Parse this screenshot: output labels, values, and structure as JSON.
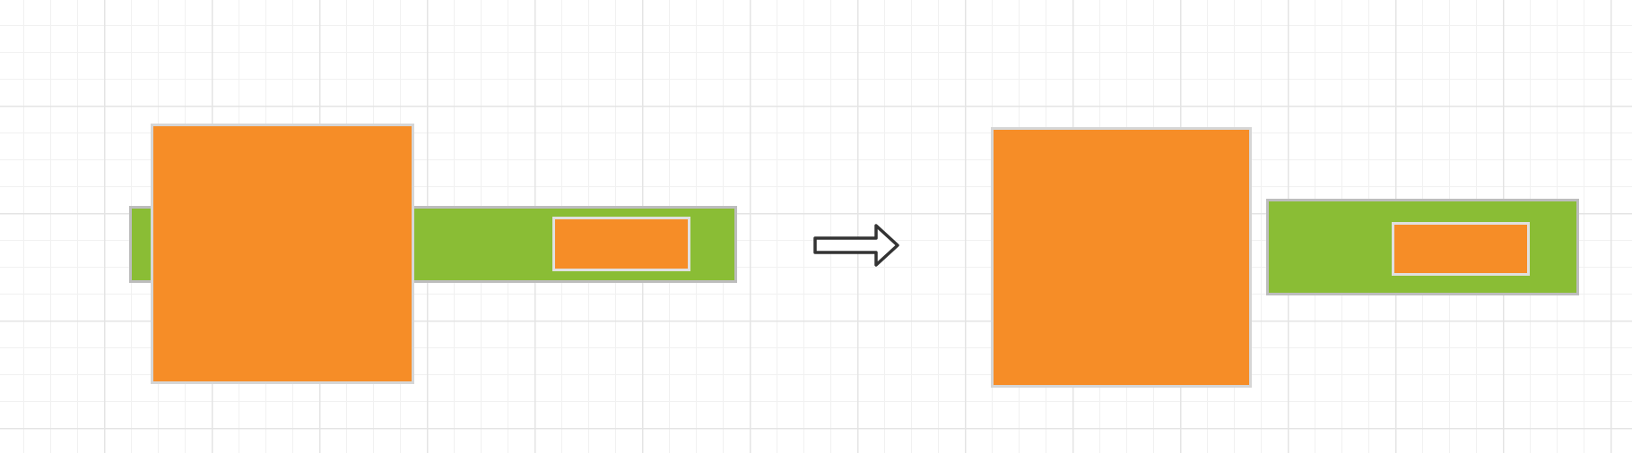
{
  "colors": {
    "green": "#8abd35",
    "orange": "#f68d27",
    "border": "#bdbdbd",
    "arrow": "#333333",
    "grid": "#e4e4e4"
  },
  "diagram": {
    "before": {
      "bar_color": "green",
      "square_color": "orange",
      "inner_box_color": "orange",
      "square_overlaps_bar": true
    },
    "transition_icon": "double-arrow-right-icon",
    "after": {
      "square_color": "orange",
      "bar_color": "green",
      "inner_box_color": "orange",
      "square_overlaps_bar": false
    }
  }
}
